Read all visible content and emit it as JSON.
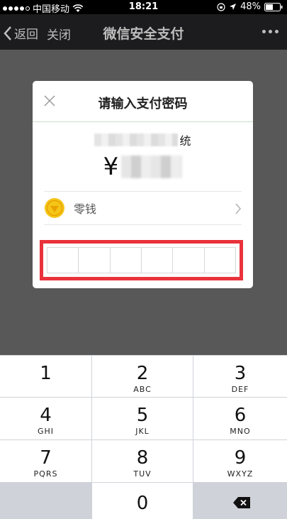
{
  "status_bar": {
    "carrier": "中国移动",
    "time": "18:21",
    "battery": "48%"
  },
  "nav": {
    "back_label": "返回",
    "close_label": "关闭",
    "title": "微信安全支付"
  },
  "dialog": {
    "title": "请输入支付密码",
    "merchant_visible_suffix": "统",
    "currency_symbol": "¥",
    "payment_method": "零钱",
    "pin_length": 6
  },
  "keypad": {
    "keys": [
      {
        "digit": "1",
        "letters": ""
      },
      {
        "digit": "2",
        "letters": "ABC"
      },
      {
        "digit": "3",
        "letters": "DEF"
      },
      {
        "digit": "4",
        "letters": "GHI"
      },
      {
        "digit": "5",
        "letters": "JKL"
      },
      {
        "digit": "6",
        "letters": "MNO"
      },
      {
        "digit": "7",
        "letters": "PQRS"
      },
      {
        "digit": "8",
        "letters": "TUV"
      },
      {
        "digit": "9",
        "letters": "WXYZ"
      },
      {
        "digit": "0",
        "letters": ""
      }
    ]
  },
  "colors": {
    "highlight": "#e9323b",
    "coin": "#f5c518",
    "nav_bg": "#1c1c1e"
  },
  "icons": [
    "wifi-icon",
    "location-arrow-icon",
    "battery-icon",
    "back-chevron-icon",
    "more-icon",
    "close-icon",
    "coin-icon",
    "chevron-right-icon",
    "delete-icon"
  ]
}
